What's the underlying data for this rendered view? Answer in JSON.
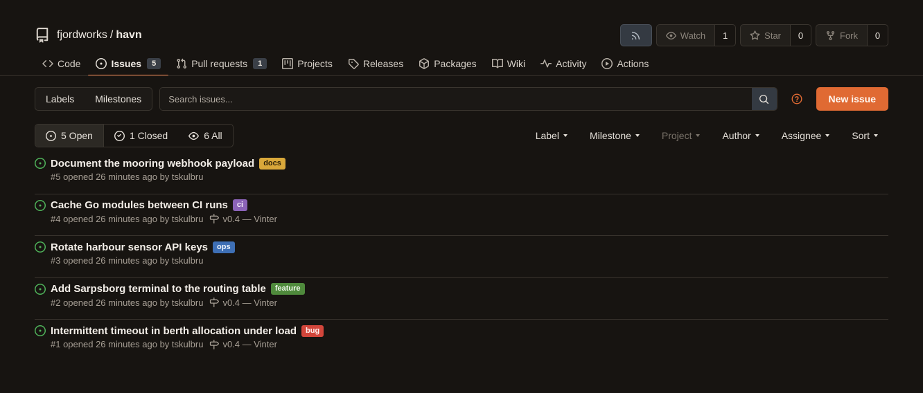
{
  "repo": {
    "owner": "fjordworks",
    "separator": "/",
    "name": "havn"
  },
  "actions": {
    "watch_label": "Watch",
    "watch_count": "1",
    "star_label": "Star",
    "star_count": "0",
    "fork_label": "Fork",
    "fork_count": "0"
  },
  "tabs": [
    {
      "label": "Code",
      "icon": "code-icon"
    },
    {
      "label": "Issues",
      "icon": "issue-opened-icon",
      "badge": "5",
      "active": true
    },
    {
      "label": "Pull requests",
      "icon": "git-pull-request-icon",
      "badge": "1"
    },
    {
      "label": "Projects",
      "icon": "project-icon"
    },
    {
      "label": "Releases",
      "icon": "tag-icon"
    },
    {
      "label": "Packages",
      "icon": "package-icon"
    },
    {
      "label": "Wiki",
      "icon": "book-icon"
    },
    {
      "label": "Activity",
      "icon": "pulse-icon"
    },
    {
      "label": "Actions",
      "icon": "play-icon"
    }
  ],
  "toolbar": {
    "labels": "Labels",
    "milestones": "Milestones",
    "search_placeholder": "Search issues...",
    "new_issue": "New issue"
  },
  "states": {
    "open": "5 Open",
    "closed": "1 Closed",
    "all": "6 All"
  },
  "filters": {
    "label": "Label",
    "milestone": "Milestone",
    "project": "Project",
    "author": "Author",
    "assignee": "Assignee",
    "sort": "Sort"
  },
  "issues": [
    {
      "title": "Document the mooring webhook payload",
      "label": "docs",
      "meta": "#5 opened 26 minutes ago by tskulbru",
      "milestone": ""
    },
    {
      "title": "Cache Go modules between CI runs",
      "label": "ci",
      "meta": "#4 opened 26 minutes ago by tskulbru",
      "milestone": "v0.4 — Vinter"
    },
    {
      "title": "Rotate harbour sensor API keys",
      "label": "ops",
      "meta": "#3 opened 26 minutes ago by tskulbru",
      "milestone": ""
    },
    {
      "title": "Add Sarpsborg terminal to the routing table",
      "label": "feature",
      "meta": "#2 opened 26 minutes ago by tskulbru",
      "milestone": "v0.4 — Vinter"
    },
    {
      "title": "Intermittent timeout in berth allocation under load",
      "label": "bug",
      "meta": "#1 opened 26 minutes ago by tskulbru",
      "milestone": "v0.4 — Vinter"
    }
  ],
  "colors": {
    "accent": "#e06a33",
    "open_state": "#4fb35a"
  }
}
